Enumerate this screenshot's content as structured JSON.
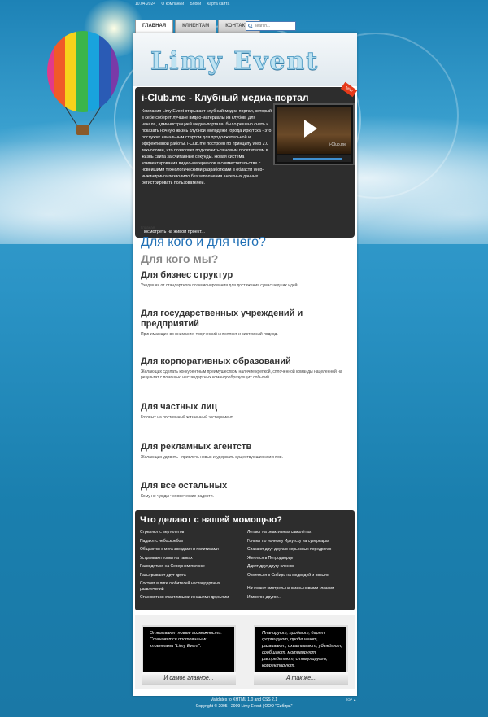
{
  "topbar": {
    "items": [
      "10.04.2024",
      "О компании",
      "Блоги",
      "Карта сайта"
    ]
  },
  "tabs": [
    {
      "label": "Главная"
    },
    {
      "label": "Клиентам"
    },
    {
      "label": "Контакты"
    }
  ],
  "search": {
    "placeholder": "search..."
  },
  "header": {
    "logo": "Limy Event"
  },
  "feature": {
    "title": "i-Club.me - Клубный медиа-портал",
    "badge": "NEW",
    "text": "Компания Limy Event открывает клубный медиа-портал, который в себе соберет лучшие видео-материалы из клубов. Для начала, администрацией медиа-портала, было решено снять и показать ночную жизнь клубной молодежи города Иркутска - это послужит начальным стартом для продолжительной и эффективной работы. i-Club.me построен по принципу Web 2.0 технологии, что позволяет подключиться новым посетителям в жизнь сайта за считанные секунды. Новая система комментирования видео-материалов в совместительстве с новейшими технологическими разработками в области Web-инжиниринга позволило без заполнения анкетных данных регистрировать пользователей.",
    "link": "Посмотреть на живой проект...",
    "video_label": "i-Club.me"
  },
  "breadcrumb": "Главная",
  "headline": {
    "main": "Для кого и для чего?",
    "sub": "Для кого мы?"
  },
  "sections": [
    {
      "title": "Для бизнес структур",
      "text": "Уходящих от стандартного позиционирования для достижения сумасшедших идей."
    },
    {
      "title": "Для государственных учреждений и предприятий",
      "text": "Принимающих во внимание, творческий интеллект и системный подход."
    },
    {
      "title": "Для корпоративных образований",
      "text": "Желающих сделать конкурентным преимуществом наличие крепкой, сплоченной команды нацеленной на результат с помощью нестандартных командообразующих событий."
    },
    {
      "title": "Для частных лиц",
      "text": "Готовых на постоянный жизненный эксперимент."
    },
    {
      "title": "Для рекламных агентств",
      "text": "Желающих удивить - привлечь новых и удержать существующих клиентов."
    },
    {
      "title": "Для все остальных",
      "text": "Кому не чужды человеческие радости."
    }
  ],
  "help": {
    "title": "Что делают с нашей момощью?",
    "left": [
      "Стреляют с вертолетов",
      "Падают с небоскребов",
      "Общаются с мега звездами и политиками",
      "Устраивают гонки на танках",
      "Разводяться на Северном полюсе",
      "Разыгрывают друг друга",
      "Состоят в лиге любителей нестандартных развлечений",
      "Становяться счастливыми и нашими друзьями"
    ],
    "right": [
      "Летают на реактивных самолётах",
      "Гоняют по ночному Иркутску на суперкарах",
      "Спасают друг друга в серьезных передрягах",
      "Женятся в Петродворце",
      "Дарят друг другу слонов",
      "Охотяться в Сибирь на медведей и овсыян",
      "Начинают смотреть на жизнь новыми глазами",
      "И многое другое..."
    ]
  },
  "cards": [
    {
      "text": "Открывают новые возможности. Становятся постоянными клиентами \"Limy Event\".",
      "caption": "И самое главное..."
    },
    {
      "text": "Планируют, продают, дарят, формируют, продвигают, развивают, охватывают, убеждают, сообщают, мотивируют, распределяют, стимулируют, корректируют.",
      "caption": "А так же..."
    }
  ],
  "footer": {
    "line1": "Validates to XHTML 1.0 and CSS 2.1",
    "line2": "Copyright © 2005 - 2009 Limy Event | ООО \"Сибирь\"",
    "top_link": "TOP ▲"
  },
  "colors": {
    "accent": "#1f6fb5",
    "panel": "#2d2d2d",
    "badge": "#e63a1a"
  }
}
